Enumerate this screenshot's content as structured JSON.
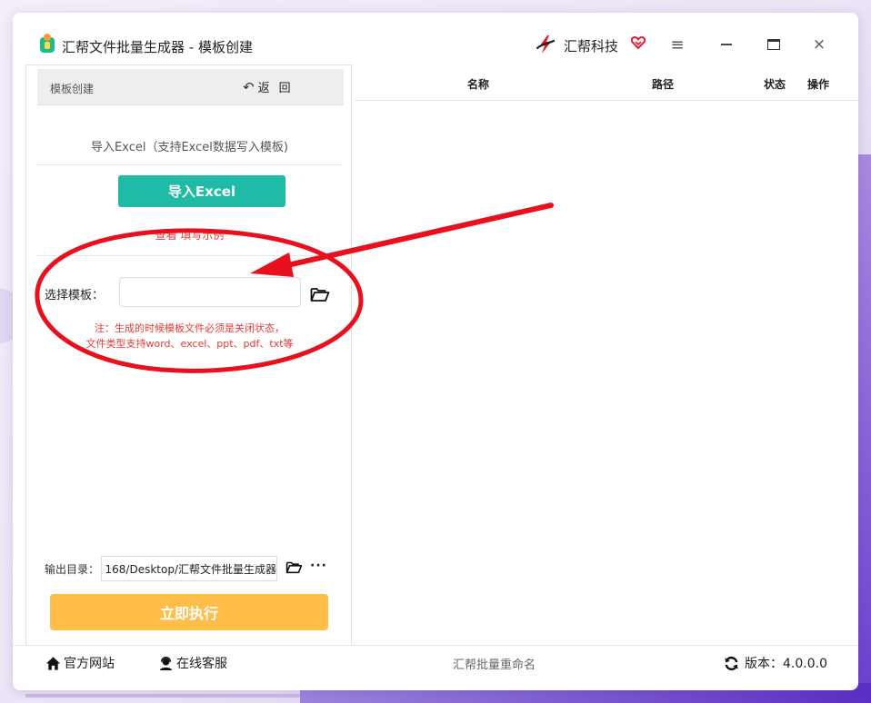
{
  "app": {
    "title": "汇帮文件批量生成器 - 模板创建",
    "brand_name": "汇帮科技"
  },
  "window_controls": {
    "menu_icon": "hamburger-icon",
    "minimize_icon": "minimize-icon",
    "maximize_icon": "maximize-icon",
    "close_icon": "close-icon",
    "close_glyph": "×",
    "menu_glyph": "≡"
  },
  "left_panel": {
    "header_title": "模板创建",
    "back_label": "返回",
    "back_glyph": "↶",
    "import_hint": "导入Excel（支持Excel数据写入模板)",
    "import_button": "导入Excel",
    "example_link": "查看 填写示例",
    "select_template_label": "选择模板：",
    "template_input_value": "",
    "template_note_line1": "注：生成的时候模板文件必须是关闭状态，",
    "template_note_line2": "文件类型支持word、excel、ppt、pdf、txt等",
    "output_label": "输出目录：",
    "output_path": "168/Desktop/汇帮文件批量生成器",
    "more_glyph": "···",
    "run_button": "立即执行"
  },
  "table": {
    "columns": [
      "名称",
      "路径",
      "状态",
      "操作"
    ],
    "rows": []
  },
  "footer": {
    "home_label": "官方网站",
    "support_label": "在线客服",
    "center_text": "汇帮批量重命名",
    "version_label": "版本：4.0.0.0"
  },
  "colors": {
    "import_button": "#20bba6",
    "run_button": "#ffbe4a",
    "note_red": "#e53935",
    "annotation_red": "#e8101c"
  }
}
